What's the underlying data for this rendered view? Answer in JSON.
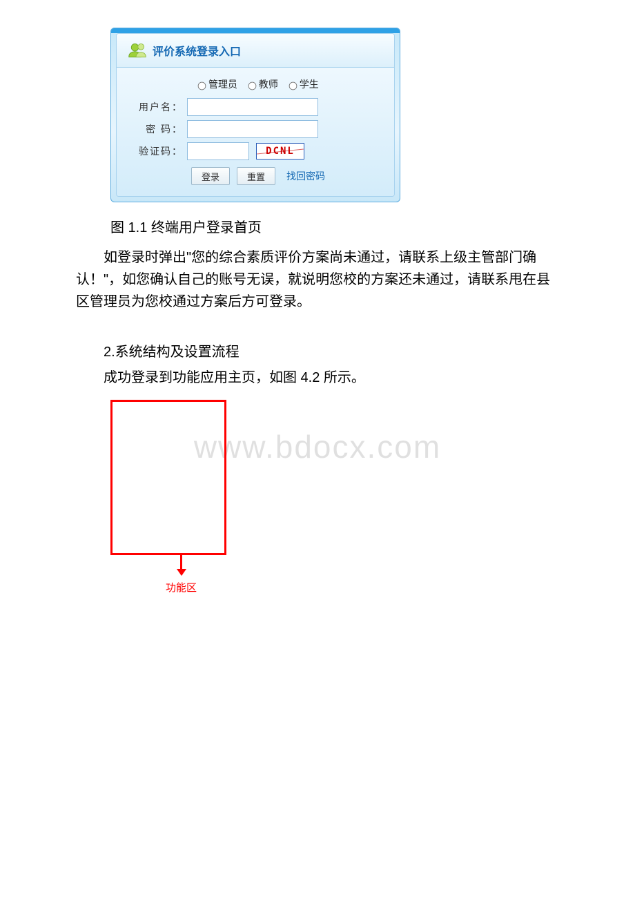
{
  "login": {
    "title": "评价系统登录入口",
    "roles": {
      "admin": "管理员",
      "teacher": "教师",
      "student": "学生"
    },
    "labels": {
      "username": "用户名：",
      "password": "密 码：",
      "captcha": "验证码："
    },
    "captcha_text": "DCNL",
    "buttons": {
      "login": "登录",
      "reset": "重置"
    },
    "links": {
      "forgot": "找回密码"
    }
  },
  "caption": "图 1.1 终端用户登录首页",
  "paragraph1": "如登录时弹出\"您的综合素质评价方案尚未通过，请联系上级主管部门确认！\"，如您确认自己的账号无误，就说明您校的方案还未通过，请联系甩在县区管理员为您校通过方案后方可登录。",
  "heading2": "2.系统结构及设置流程",
  "paragraph2": "成功登录到功能应用主页，如图 4.2 所示。",
  "diagram_label": "功能区",
  "watermark": "www.bdocx.com"
}
